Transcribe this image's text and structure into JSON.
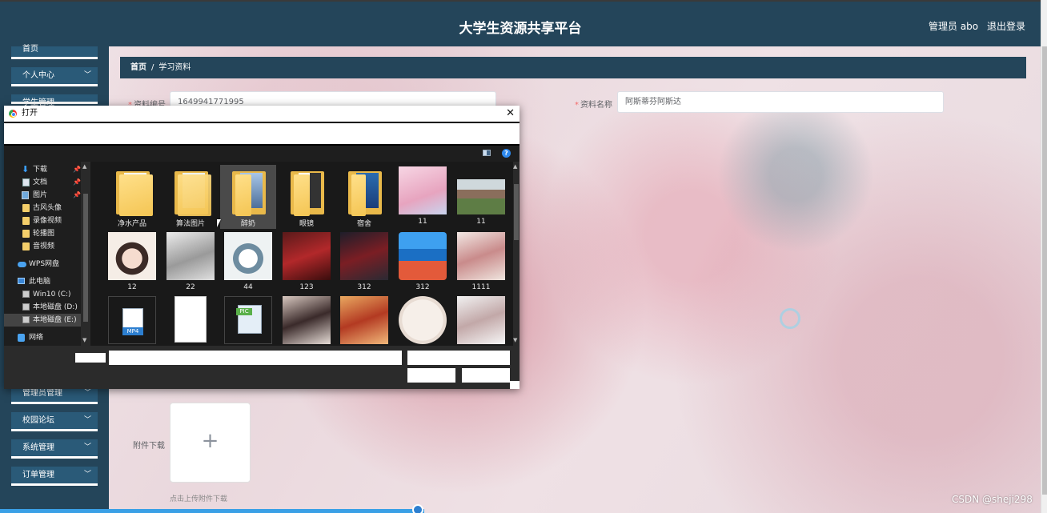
{
  "header": {
    "title": "大学生资源共享平台",
    "admin": "管理员 abo",
    "logout": "退出登录"
  },
  "sidebar": {
    "items": [
      {
        "label": "首页"
      },
      {
        "label": "个人中心"
      },
      {
        "label": "学生管理"
      },
      {
        "label": "管理员管理"
      },
      {
        "label": "校园论坛"
      },
      {
        "label": "系统管理"
      },
      {
        "label": "订单管理"
      }
    ]
  },
  "breadcrumb": {
    "home": "首页",
    "separator": "/",
    "current": "学习资料"
  },
  "form": {
    "id_label": "资料编号",
    "id_value": "1649941771995",
    "name_label": "资料名称",
    "name_value": "阿斯蒂芬阿斯达",
    "attachment_label": "附件下载",
    "attachment_hint": "点击上传附件下载"
  },
  "dialog": {
    "title": "打开",
    "nav": [
      {
        "label": "下载",
        "icon": "download-icon",
        "pinned": true
      },
      {
        "label": "文档",
        "icon": "document-icon",
        "pinned": true
      },
      {
        "label": "图片",
        "icon": "pictures-icon",
        "pinned": true
      },
      {
        "label": "古风头像",
        "icon": "folder-icon"
      },
      {
        "label": "录像视频",
        "icon": "folder-icon"
      },
      {
        "label": "轮播图",
        "icon": "folder-icon"
      },
      {
        "label": "音视频",
        "icon": "folder-icon"
      },
      {
        "label": "WPS网盘",
        "icon": "cloud-icon"
      },
      {
        "label": "此电脑",
        "icon": "computer-icon"
      },
      {
        "label": "Win10 (C:)",
        "icon": "drive-icon"
      },
      {
        "label": "本地磁盘 (D:)",
        "icon": "drive-icon"
      },
      {
        "label": "本地磁盘 (E:)",
        "icon": "drive-icon",
        "selected": true
      },
      {
        "label": "网络",
        "icon": "network-icon"
      }
    ],
    "files": [
      {
        "name": "净水产品",
        "kind": "folder"
      },
      {
        "name": "算法图片",
        "kind": "folder"
      },
      {
        "name": "醉奶",
        "kind": "folder",
        "selected": true
      },
      {
        "name": "眼镜",
        "kind": "folder"
      },
      {
        "name": "宿舍",
        "kind": "folder"
      },
      {
        "name": "11",
        "kind": "image"
      },
      {
        "name": "11",
        "kind": "image"
      },
      {
        "name": "12",
        "kind": "image"
      },
      {
        "name": "22",
        "kind": "image"
      },
      {
        "name": "44",
        "kind": "image"
      },
      {
        "name": "123",
        "kind": "image"
      },
      {
        "name": "312",
        "kind": "image"
      },
      {
        "name": "312",
        "kind": "archive"
      },
      {
        "name": "1111",
        "kind": "image"
      },
      {
        "name": "",
        "kind": "video"
      },
      {
        "name": "",
        "kind": "document"
      },
      {
        "name": "",
        "kind": "image-file"
      },
      {
        "name": "",
        "kind": "image"
      },
      {
        "name": "",
        "kind": "image"
      },
      {
        "name": "",
        "kind": "image"
      },
      {
        "name": "",
        "kind": "image"
      }
    ],
    "mp4_badge": "MP4",
    "pic_badge": "PIC",
    "close": "✕",
    "help": "?"
  },
  "watermark": "CSDN @sheji298",
  "colors": {
    "header": "#24455a",
    "sidebar_item": "#2a5a78",
    "dialog_bg": "#2b2b2b",
    "required": "#f56c6c"
  }
}
